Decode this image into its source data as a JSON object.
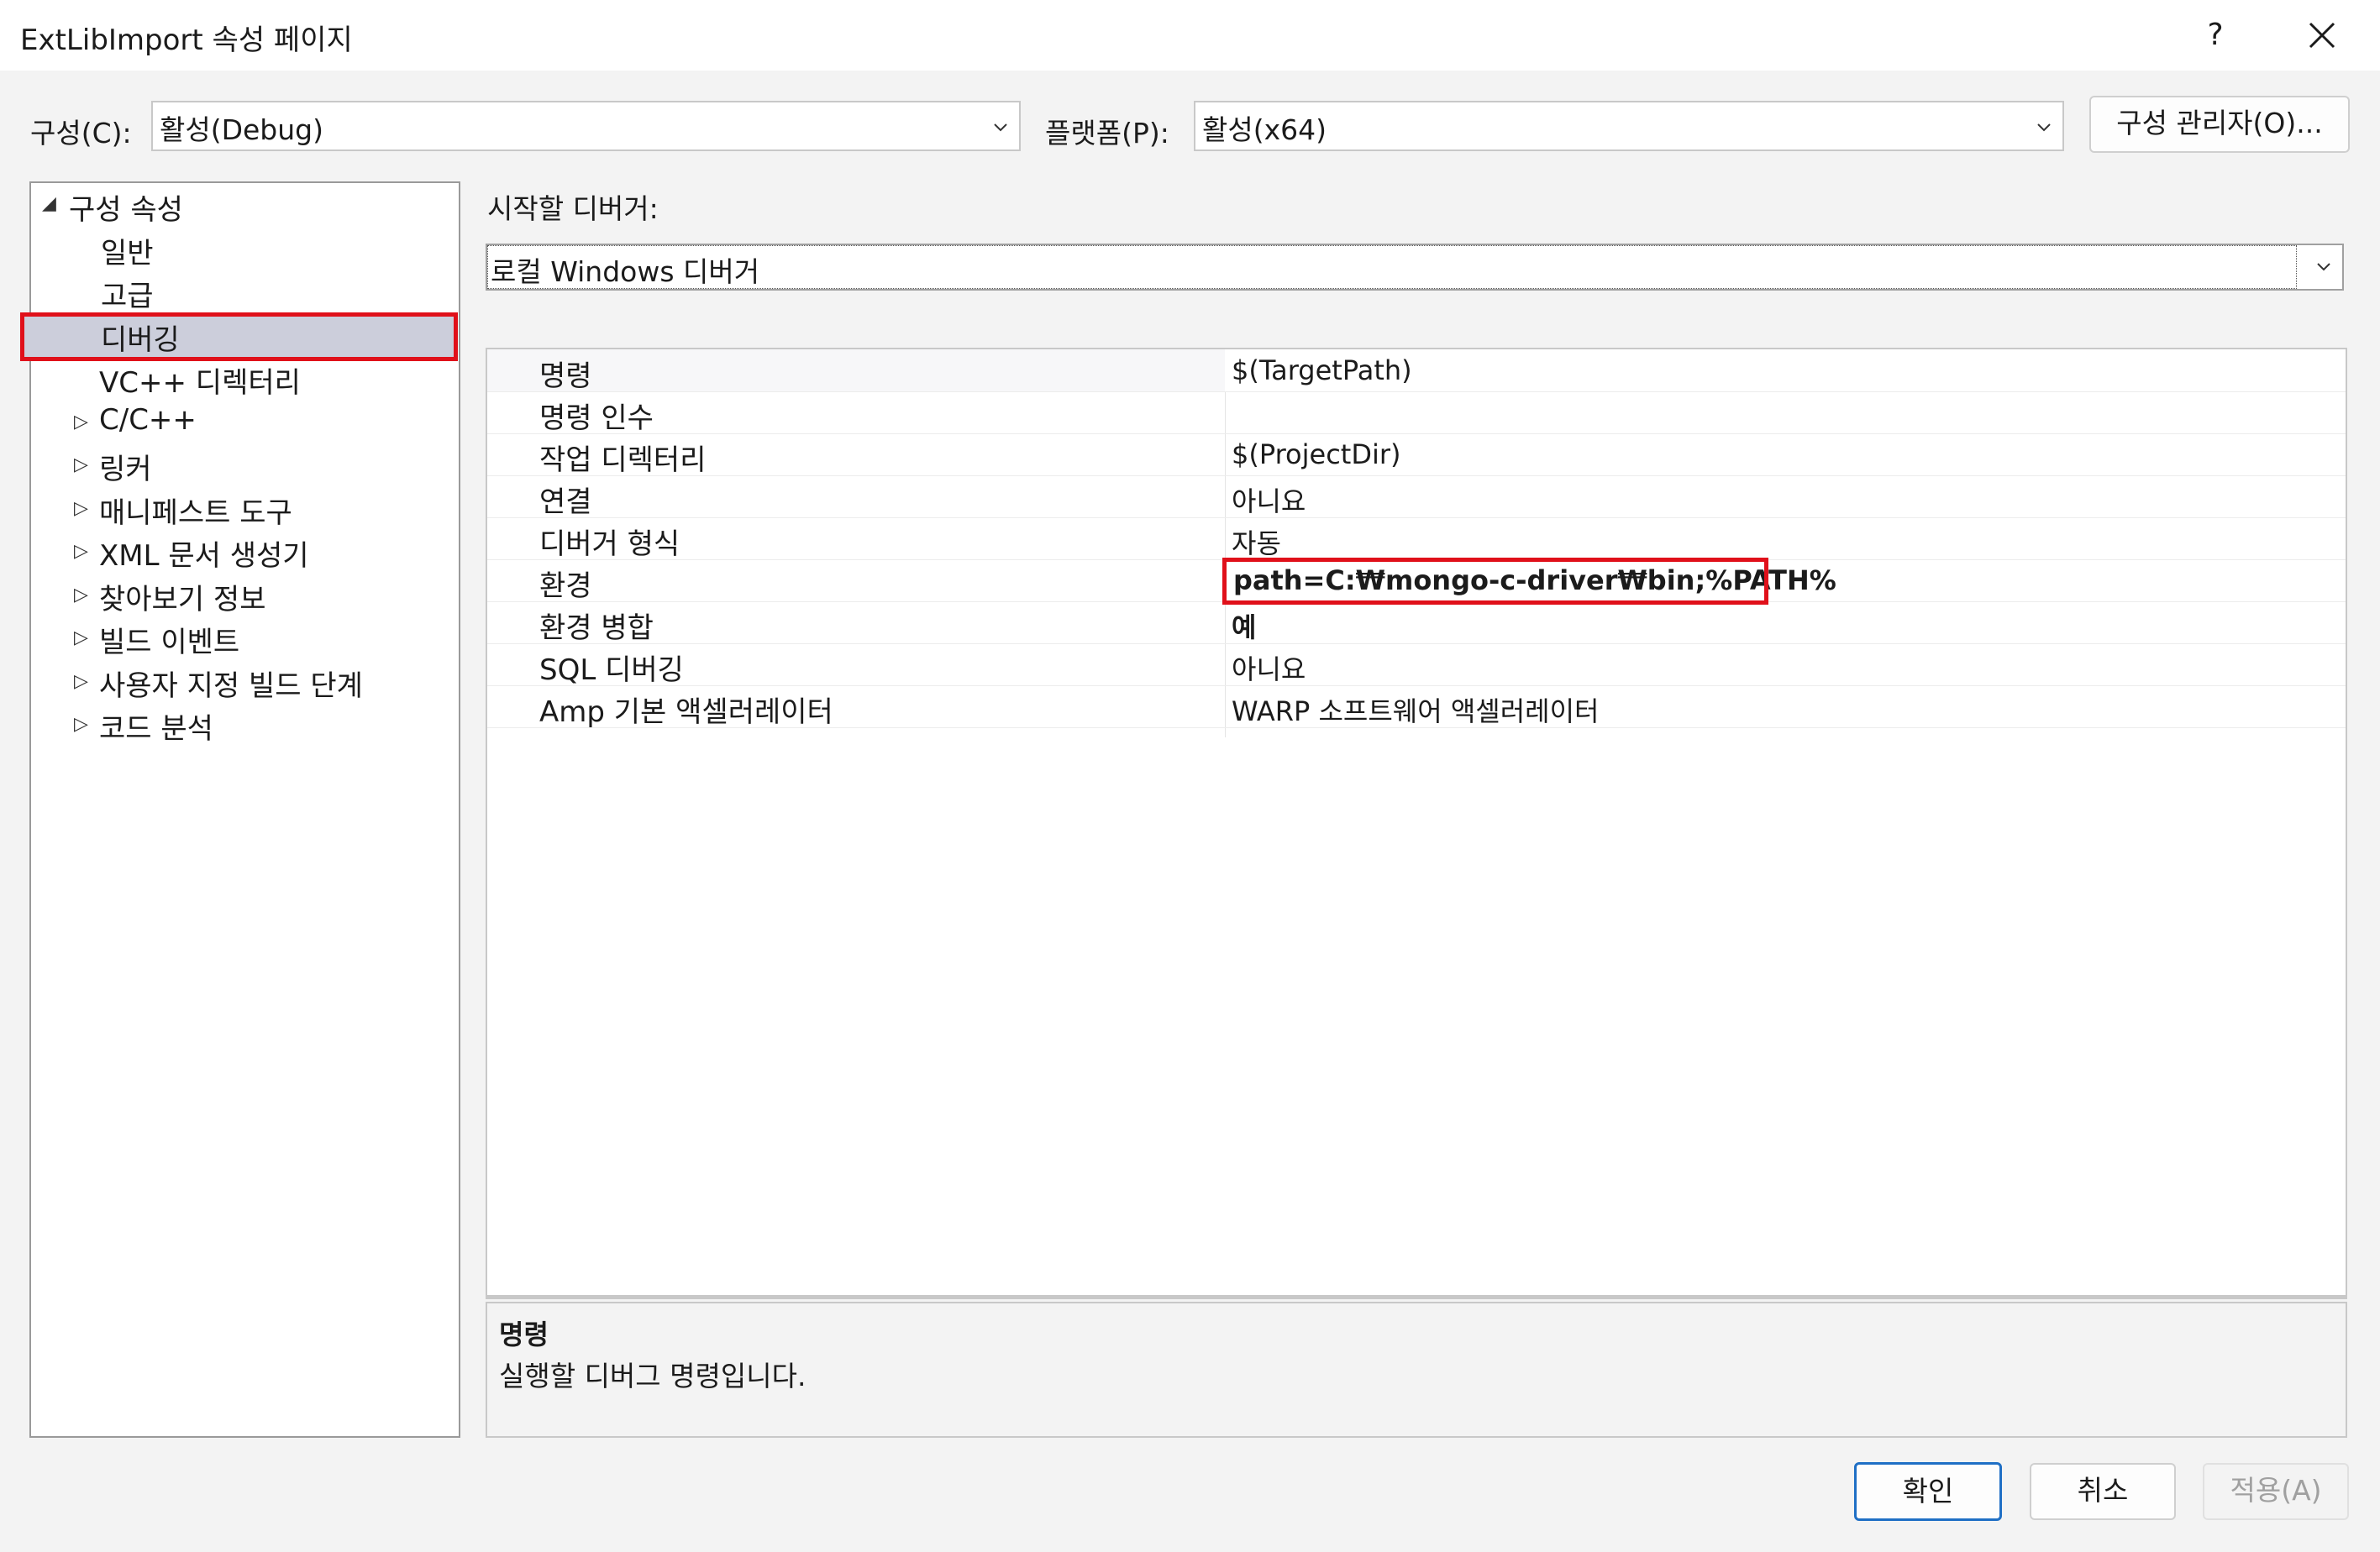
{
  "window": {
    "title": "ExtLibImport 속성 페이지",
    "help_label": "?",
    "close_label": "✕"
  },
  "toolbar": {
    "config_label": "구성(C):",
    "config_value": "활성(Debug)",
    "platform_label": "플랫폼(P):",
    "platform_value": "활성(x64)",
    "config_manager_label": "구성 관리자(O)..."
  },
  "tree": {
    "root": "구성 속성",
    "items": [
      {
        "label": "일반",
        "expandable": false
      },
      {
        "label": "고급",
        "expandable": false
      },
      {
        "label": "디버깅",
        "expandable": false,
        "selected": true
      },
      {
        "label": "VC++ 디렉터리",
        "expandable": false
      },
      {
        "label": "C/C++",
        "expandable": true
      },
      {
        "label": "링커",
        "expandable": true
      },
      {
        "label": "매니페스트 도구",
        "expandable": true
      },
      {
        "label": "XML 문서 생성기",
        "expandable": true
      },
      {
        "label": "찾아보기 정보",
        "expandable": true
      },
      {
        "label": "빌드 이벤트",
        "expandable": true
      },
      {
        "label": "사용자 지정 빌드 단계",
        "expandable": true
      },
      {
        "label": "코드 분석",
        "expandable": true
      }
    ]
  },
  "debugger": {
    "label": "시작할 디버거:",
    "value": "로컬 Windows 디버거"
  },
  "properties": [
    {
      "name": "명령",
      "value": "$(TargetPath)"
    },
    {
      "name": "명령 인수",
      "value": ""
    },
    {
      "name": "작업 디렉터리",
      "value": "$(ProjectDir)"
    },
    {
      "name": "연결",
      "value": "아니요"
    },
    {
      "name": "디버거 형식",
      "value": "자동"
    },
    {
      "name": "환경",
      "value": "path=C:₩mongo-c-driver₩bin;%PATH%",
      "bold": true,
      "highlighted": true
    },
    {
      "name": "환경 병합",
      "value": "예",
      "bold": true
    },
    {
      "name": "SQL 디버깅",
      "value": "아니요"
    },
    {
      "name": "Amp 기본 액셀러레이터",
      "value": "WARP 소프트웨어 액셀러레이터"
    }
  ],
  "description": {
    "title": "명령",
    "text": "실행할 디버그 명령입니다."
  },
  "buttons": {
    "ok": "확인",
    "cancel": "취소",
    "apply": "적용(A)"
  },
  "colors": {
    "highlight_red": "#e0101a",
    "selection": "#cccedb",
    "ok_border": "#1f6fc5"
  }
}
